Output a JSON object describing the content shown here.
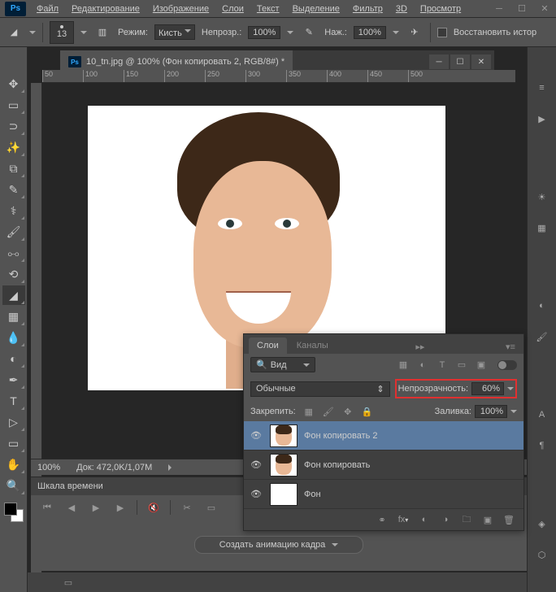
{
  "app": {
    "logo": "Ps"
  },
  "menu": [
    "Файл",
    "Редактирование",
    "Изображение",
    "Слои",
    "Текст",
    "Выделение",
    "Фильтр",
    "3D",
    "Просмотр"
  ],
  "options": {
    "mode_label": "Режим:",
    "mode_value": "Кисть",
    "opacity_label": "Непрозр.:",
    "opacity_value": "100%",
    "flow_label": "Наж.:",
    "flow_value": "100%",
    "restore_label": "Восстановить истор",
    "brush_size": "13"
  },
  "document": {
    "title": "10_tn.jpg @ 100% (Фон копировать 2, RGB/8#) *"
  },
  "ruler_ticks": [
    "50",
    "100",
    "150",
    "200",
    "250",
    "300",
    "350",
    "400",
    "450",
    "500"
  ],
  "status": {
    "zoom": "100%",
    "doc_size": "Док: 472,0K/1,07M"
  },
  "timeline": {
    "title": "Шкала времени",
    "create_btn": "Создать анимацию кадра"
  },
  "layers_panel": {
    "tabs": [
      "Слои",
      "Каналы"
    ],
    "search_label": "Вид",
    "blend_mode": "Обычные",
    "opacity_label": "Непрозрачность:",
    "opacity_value": "60%",
    "lock_label": "Закрепить:",
    "fill_label": "Заливка:",
    "fill_value": "100%",
    "layers": [
      {
        "name": "Фон копировать 2",
        "selected": true,
        "thumb": "face"
      },
      {
        "name": "Фон копировать",
        "selected": false,
        "thumb": "face"
      },
      {
        "name": "Фон",
        "selected": false,
        "thumb": "white"
      }
    ]
  }
}
